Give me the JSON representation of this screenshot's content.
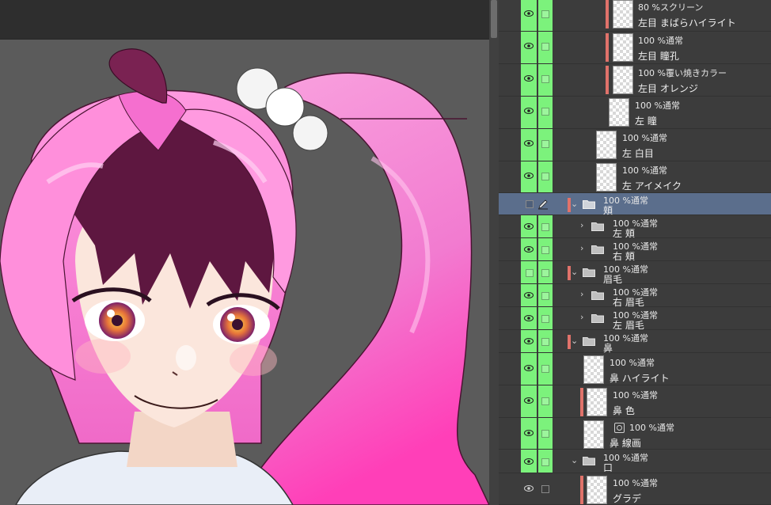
{
  "layers": [
    {
      "mode": "80 %スクリーン",
      "name": "左目 まばらハイライト"
    },
    {
      "mode": "100 %通常",
      "name": "左目 瞳孔"
    },
    {
      "mode": "100 %覆い焼きカラー",
      "name": "左目 オレンジ"
    },
    {
      "mode": "100 %通常",
      "name": "左 瞳"
    },
    {
      "mode": "100 %通常",
      "name": "左 白目"
    },
    {
      "mode": "100 %通常",
      "name": "左 アイメイク"
    },
    {
      "mode": "100 %通常",
      "name": "頬"
    },
    {
      "mode": "100 %通常",
      "name": "左 頬"
    },
    {
      "mode": "100 %通常",
      "name": "右 頬"
    },
    {
      "mode": "100 %通常",
      "name": "眉毛"
    },
    {
      "mode": "100 %通常",
      "name": "右 眉毛"
    },
    {
      "mode": "100 %通常",
      "name": "左 眉毛"
    },
    {
      "mode": "100 %通常",
      "name": "鼻"
    },
    {
      "mode": "100 %通常",
      "name": "鼻 ハイライト"
    },
    {
      "mode": "100 %通常",
      "name": "鼻 色"
    },
    {
      "mode": "100 %通常",
      "name": "鼻 線画"
    },
    {
      "mode": "100 %通常",
      "name": "口"
    },
    {
      "mode": "100 %通常",
      "name": "グラデ"
    }
  ],
  "colors": {
    "visibility_column": "#7cf27c",
    "selected_row": "#5b6e8c",
    "layer_color_tag": "#e0726a",
    "canvas_background": "#5b5b5b"
  }
}
